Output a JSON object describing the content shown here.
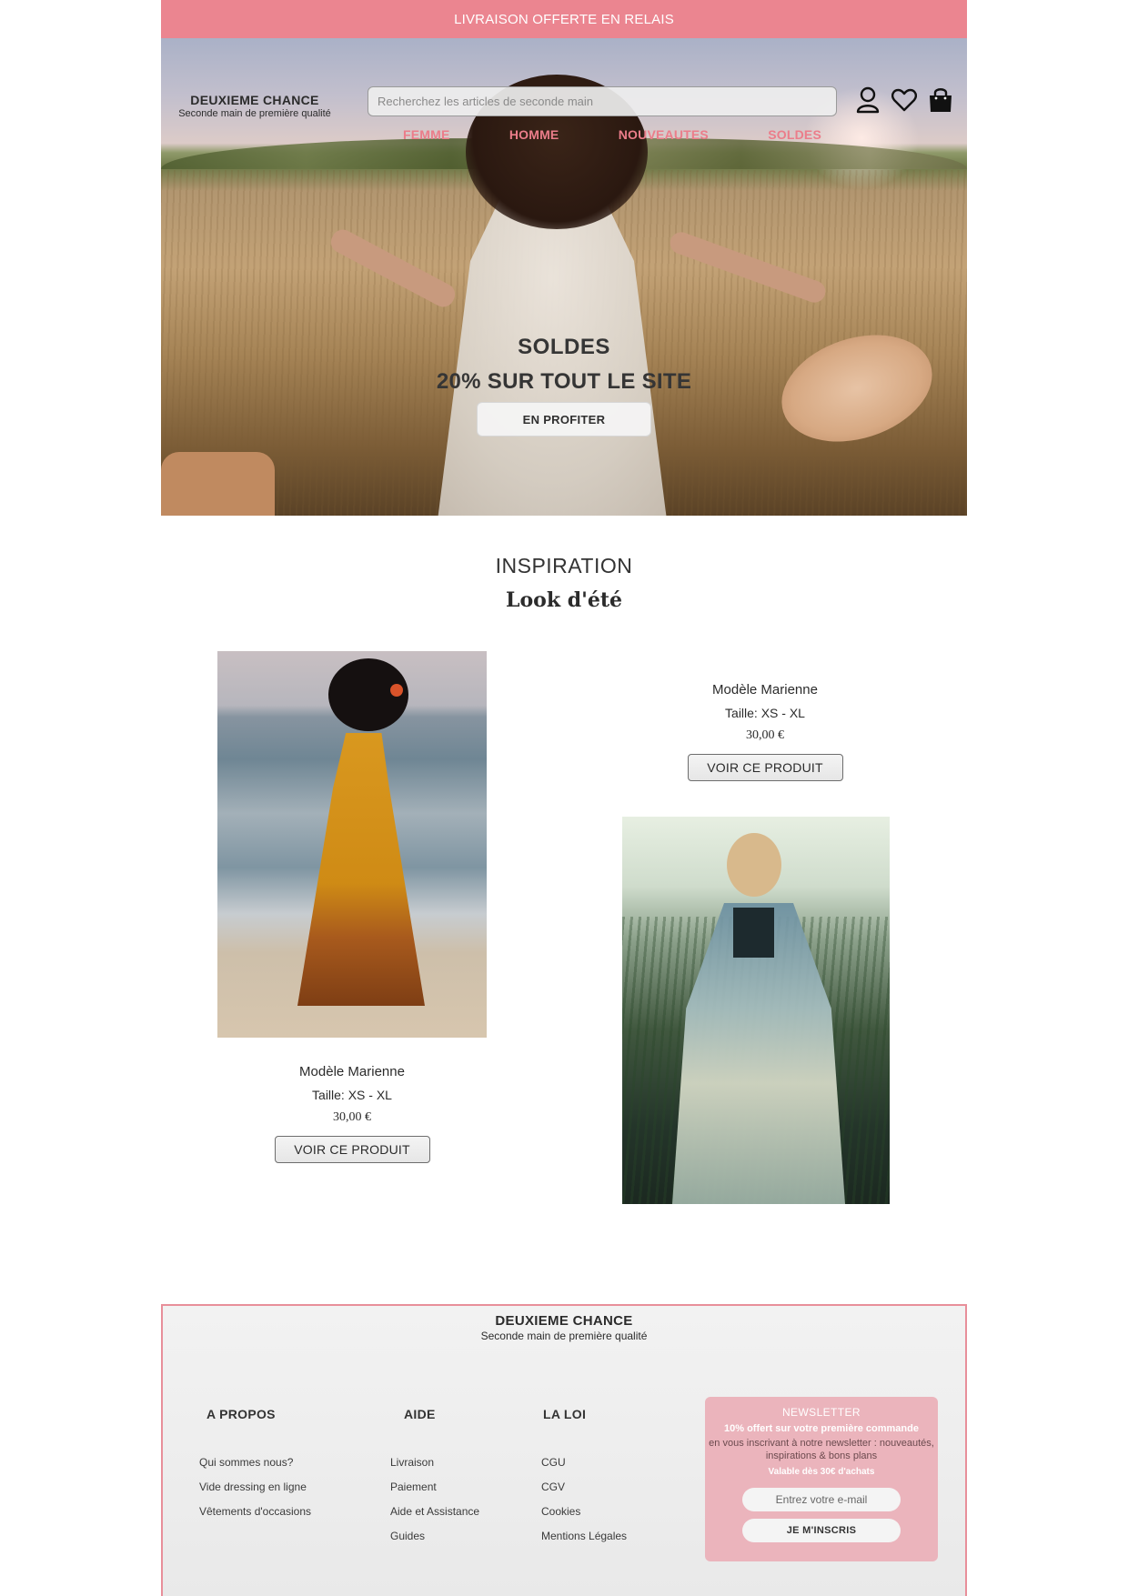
{
  "promo": {
    "text": "LIVRAISON OFFERTE EN RELAIS"
  },
  "brand": {
    "name": "DEUXIEME CHANCE",
    "tagline": "Seconde main de première qualité"
  },
  "search": {
    "placeholder": "Recherchez les articles de seconde main"
  },
  "header_icons": [
    "user-icon",
    "heart-icon",
    "shopping-bag-icon"
  ],
  "nav": {
    "items": [
      "FEMME",
      "HOMME",
      "NOUVEAUTES",
      "SOLDES"
    ]
  },
  "hero": {
    "line1": "SOLDES",
    "line2": "20% SUR TOUT LE SITE",
    "cta": "EN PROFITER"
  },
  "inspiration": {
    "title": "INSPIRATION",
    "subtitle": "Look d'été"
  },
  "products": [
    {
      "name": "Modèle Marienne",
      "size": "Taille: XS - XL",
      "price": "30,00 €",
      "button": "VOIR CE PRODUIT"
    },
    {
      "name": "Modèle Marienne",
      "size": "Taille: XS - XL",
      "price": "30,00 €",
      "button": "VOIR CE PRODUIT"
    }
  ],
  "footer": {
    "brand_name": "DEUXIEME CHANCE",
    "brand_tagline": "Seconde main de première qualité",
    "columns": [
      {
        "title": "A PROPOS",
        "links": [
          "Qui sommes nous?",
          "Vide dressing en ligne",
          "Vêtements d'occasions"
        ]
      },
      {
        "title": "AIDE",
        "links": [
          "Livraison",
          "Paiement",
          "Aide et Assistance",
          "Guides"
        ]
      },
      {
        "title": "LA LOI",
        "links": [
          "CGU",
          "CGV",
          "Cookies",
          "Mentions Légales"
        ]
      }
    ],
    "newsletter": {
      "title": "NEWSLETTER",
      "offer": "10% offert sur votre première commande",
      "desc": "en vous inscrivant à notre newsletter : nouveautés, inspirations & bons plans",
      "valid": "Valable dès 30€ d'achats",
      "email_placeholder": "Entrez votre e-mail",
      "button": "JE M'INSCRIS"
    }
  },
  "colors": {
    "accent": "#eb8590",
    "nav": "#eb7d8a",
    "newsletter_bg": "#ebb4bc",
    "footer_border": "#e88f9a"
  }
}
